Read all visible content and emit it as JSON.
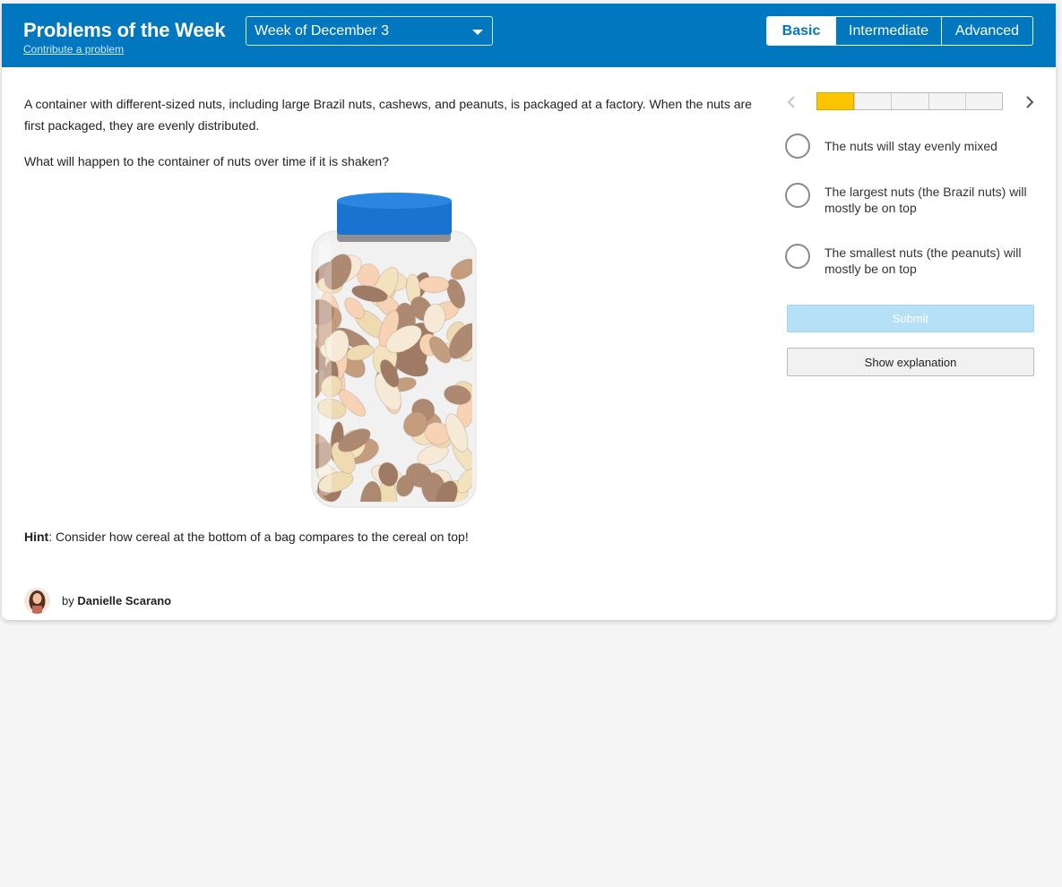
{
  "header": {
    "title": "Problems of the Week",
    "contribute_link": "Contribute a problem",
    "week_select": {
      "selected": "Week of December 3",
      "icon": "chevron-down-icon"
    },
    "levels": [
      {
        "label": "Basic",
        "active": true
      },
      {
        "label": "Intermediate",
        "active": false
      },
      {
        "label": "Advanced",
        "active": false
      }
    ]
  },
  "problem": {
    "text": "A container with different-sized nuts, including large Brazil nuts, cashews, and peanuts, is packaged at a factory. When the nuts are first packaged, they are evenly distributed.",
    "question": "What will happen to the container of nuts over time if it is shaken?",
    "hint_label": "Hint",
    "hint_text": ": Consider how cereal at the bottom of a bag compares to the cereal on top!"
  },
  "author": {
    "by": "by",
    "name": "Danielle Scarano"
  },
  "progress": {
    "current": 1,
    "total": 5
  },
  "options": [
    "The nuts will stay evenly mixed",
    "The largest nuts (the Brazil nuts) will mostly be on top",
    "The smallest nuts (the peanuts) will mostly be on top"
  ],
  "buttons": {
    "submit": "Submit",
    "explanation": "Show explanation"
  },
  "colors": {
    "header": "#0177bf",
    "progress_fill": "#fbc600",
    "submit_disabled": "#b6e0f6",
    "lid": "#1a73d0"
  }
}
